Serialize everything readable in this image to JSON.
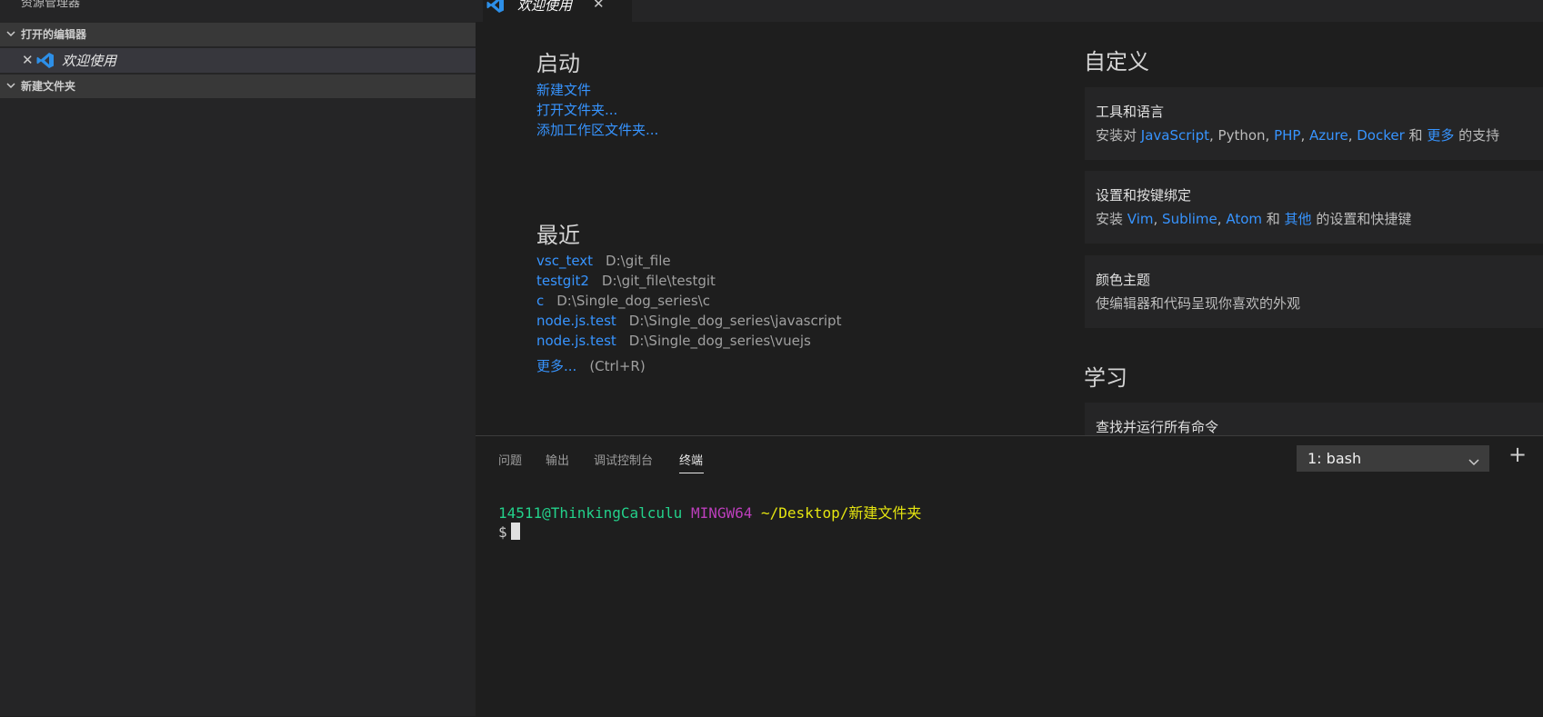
{
  "sidebar": {
    "title": "资源管理器",
    "open_editors": {
      "label": "打开的编辑器",
      "items": [
        {
          "close": "✕",
          "label": "欢迎使用",
          "icon": "vscode-logo-icon"
        }
      ]
    },
    "folder": {
      "label": "新建文件夹"
    }
  },
  "editor": {
    "tab": {
      "label": "欢迎使用",
      "close": "✕",
      "icon": "vscode-logo-icon"
    },
    "start": {
      "heading": "启动",
      "links": [
        "新建文件",
        "打开文件夹...",
        "添加工作区文件夹..."
      ]
    },
    "recent": {
      "heading": "最近",
      "items": [
        {
          "name": "vsc_text",
          "path": "D:\\git_file"
        },
        {
          "name": "testgit2",
          "path": "D:\\git_file\\testgit"
        },
        {
          "name": "c",
          "path": "D:\\Single_dog_series\\c"
        },
        {
          "name": "node.js.test",
          "path": "D:\\Single_dog_series\\javascript"
        },
        {
          "name": "node.js.test",
          "path": "D:\\Single_dog_series\\vuejs"
        }
      ],
      "more_label": "更多...",
      "more_hint": "(Ctrl+R)"
    },
    "customize": {
      "heading": "自定义",
      "tools": {
        "title": "工具和语言",
        "p1": "安装对 ",
        "js": "JavaScript",
        "p2": ", Python, ",
        "php": "PHP",
        "p3": ", ",
        "azure": "Azure",
        "p4": ", ",
        "docker": "Docker",
        "p5": " 和 ",
        "more": "更多",
        "p6": " 的支持"
      },
      "keys": {
        "title": "设置和按键绑定",
        "p1": "安装 ",
        "vim": "Vim",
        "p2": ", ",
        "sublime": "Sublime",
        "p3": ", ",
        "atom": "Atom",
        "p4": " 和 ",
        "others": "其他",
        "p5": " 的设置和快捷键"
      },
      "theme": {
        "title": "颜色主题",
        "desc": "使编辑器和代码呈现你喜欢的外观"
      }
    },
    "learn": {
      "heading": "学习",
      "card_title": "查找并运行所有命令"
    }
  },
  "panel": {
    "tabs": [
      "问题",
      "输出",
      "调试控制台",
      "终端"
    ],
    "active_tab": "终端",
    "terminal_select": "1: bash",
    "add_button": "+",
    "terminal": {
      "user": "14511@ThinkingCalculu",
      "host": "MINGW64",
      "path": "~/Desktop/新建文件夹",
      "prompt": "$"
    }
  },
  "colors": {
    "link": "#3794ff",
    "sidebar_bg": "#252526",
    "editor_bg": "#1e1e1e",
    "term_user": "#23d18b",
    "term_host": "#bc3fbc",
    "term_path": "#e5e510"
  }
}
